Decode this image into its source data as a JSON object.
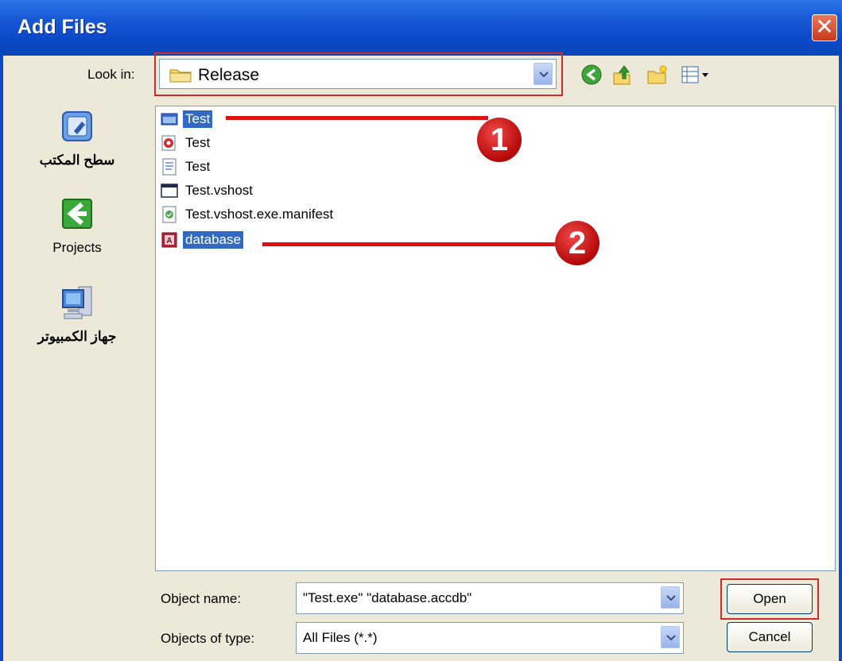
{
  "window": {
    "title": "Add Files",
    "close_glyph": "✕"
  },
  "look_in": {
    "label": "Look in:",
    "value": "Release"
  },
  "toolbar": {
    "icons": [
      "back-icon",
      "up-folder-icon",
      "new-folder-icon",
      "views-menu-icon"
    ]
  },
  "places": [
    {
      "label": "سطح المكتب",
      "icon": "desktop-icon"
    },
    {
      "label": "Projects",
      "icon": "back-arrow-icon"
    },
    {
      "label": "جهاز الكمبيوتر",
      "icon": "computer-icon"
    }
  ],
  "files": [
    {
      "name": "Test",
      "icon": "exe-icon",
      "selected": true
    },
    {
      "name": "Test",
      "icon": "pdb-icon",
      "selected": false
    },
    {
      "name": "Test",
      "icon": "config-icon",
      "selected": false
    },
    {
      "name": "Test.vshost",
      "icon": "window-icon",
      "selected": false
    },
    {
      "name": "Test.vshost.exe.manifest",
      "icon": "manifest-icon",
      "selected": false
    },
    {
      "name": "database",
      "icon": "access-db-icon",
      "selected": true
    }
  ],
  "callouts": [
    "1",
    "2"
  ],
  "object_name": {
    "label": "Object name:",
    "value": "\"Test.exe\" \"database.accdb\""
  },
  "objects_of_type": {
    "label": "Objects of type:",
    "value": "All Files (*.*)"
  },
  "buttons": {
    "open": "Open",
    "cancel": "Cancel"
  },
  "colors": {
    "selection": "#316ac5",
    "highlight": "#d02b2b",
    "titlebar": "#0a49c9"
  }
}
